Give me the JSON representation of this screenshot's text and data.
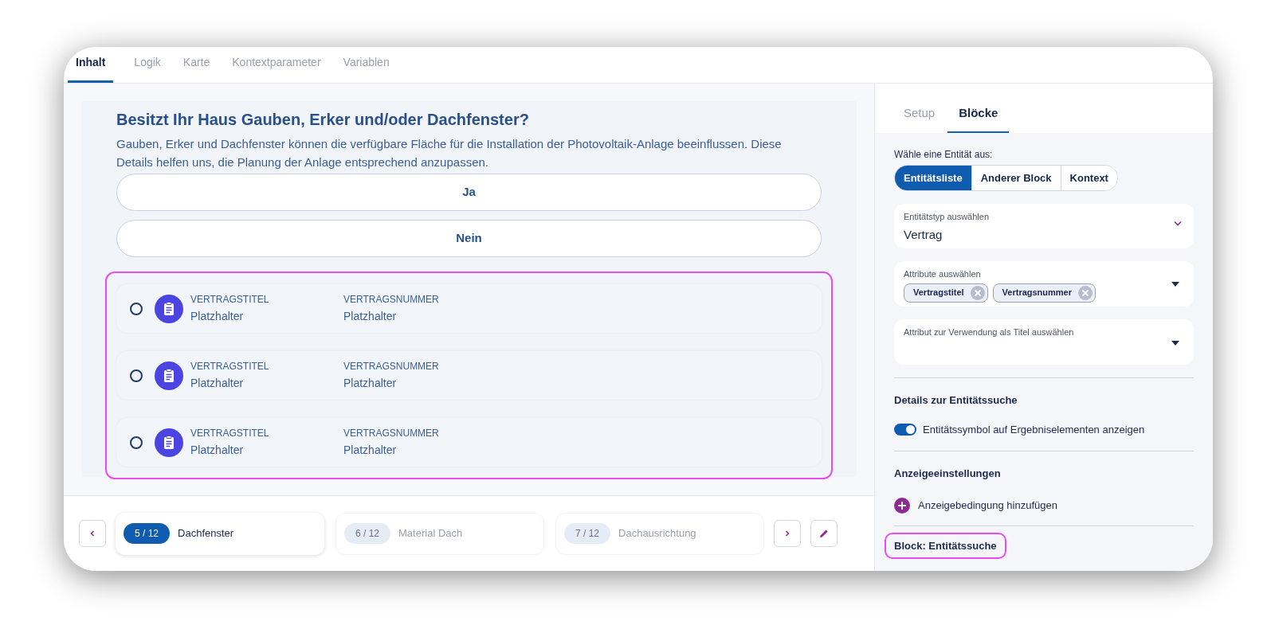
{
  "top_tabs": [
    {
      "label": "Inhalt",
      "selected": true
    },
    {
      "label": "Logik",
      "selected": false
    },
    {
      "label": "Karte",
      "selected": false
    },
    {
      "label": "Kontextparameter",
      "selected": false
    },
    {
      "label": "Variablen",
      "selected": false
    }
  ],
  "question": {
    "title": "Besitzt Ihr Haus Gauben, Erker und/oder Dachfenster?",
    "description": "Gauben, Erker und Dachfenster können die verfügbare Fläche für die Installation der Photovoltaik-Anlage beeinflussen. Diese Details helfen uns, die Planung der Anlage entsprechend anzupassen.",
    "answers": [
      "Ja",
      "Nein"
    ]
  },
  "results": [
    {
      "selected": false,
      "fields": [
        {
          "label": "VERTRAGSTITEL",
          "value": "Platzhalter"
        },
        {
          "label": "VERTRAGSNUMMER",
          "value": "Platzhalter"
        }
      ]
    },
    {
      "selected": false,
      "fields": [
        {
          "label": "VERTRAGSTITEL",
          "value": "Platzhalter"
        },
        {
          "label": "VERTRAGSNUMMER",
          "value": "Platzhalter"
        }
      ]
    },
    {
      "selected": false,
      "fields": [
        {
          "label": "VERTRAGSTITEL",
          "value": "Platzhalter"
        },
        {
          "label": "VERTRAGSNUMMER",
          "value": "Platzhalter"
        }
      ]
    }
  ],
  "steps": [
    {
      "badge": "5 / 12",
      "label": "Dachfenster",
      "selected": true
    },
    {
      "badge": "6 / 12",
      "label": "Material Dach",
      "selected": false
    },
    {
      "badge": "7 / 12",
      "label": "Dachausrichtung",
      "selected": false
    }
  ],
  "side_tabs": [
    {
      "label": "Setup",
      "selected": false
    },
    {
      "label": "Blöcke",
      "selected": true
    }
  ],
  "entity_choice": {
    "label": "Wähle eine Entität aus:",
    "options": [
      {
        "label": "Entitätsliste",
        "selected": true
      },
      {
        "label": "Anderer Block",
        "selected": false
      },
      {
        "label": "Kontext",
        "selected": false
      }
    ]
  },
  "entity_type": {
    "label": "Entitätstyp auswählen",
    "value": "Vertrag"
  },
  "attributes": {
    "label": "Attribute auswählen",
    "chips": [
      "Vertragstitel",
      "Vertragsnummer"
    ]
  },
  "title_attribute": {
    "label": "Attribut zur Verwendung als Titel auswählen"
  },
  "search_details": {
    "heading": "Details zur Entitätssuche",
    "toggle_label": "Entitätssymbol auf Ergebniselementen anzeigen",
    "on": true
  },
  "display_settings": {
    "heading": "Anzeigeeinstellungen",
    "add_label": "Anzeigebedingung hinzufügen"
  },
  "block_label": "Block: Entitätssuche"
}
